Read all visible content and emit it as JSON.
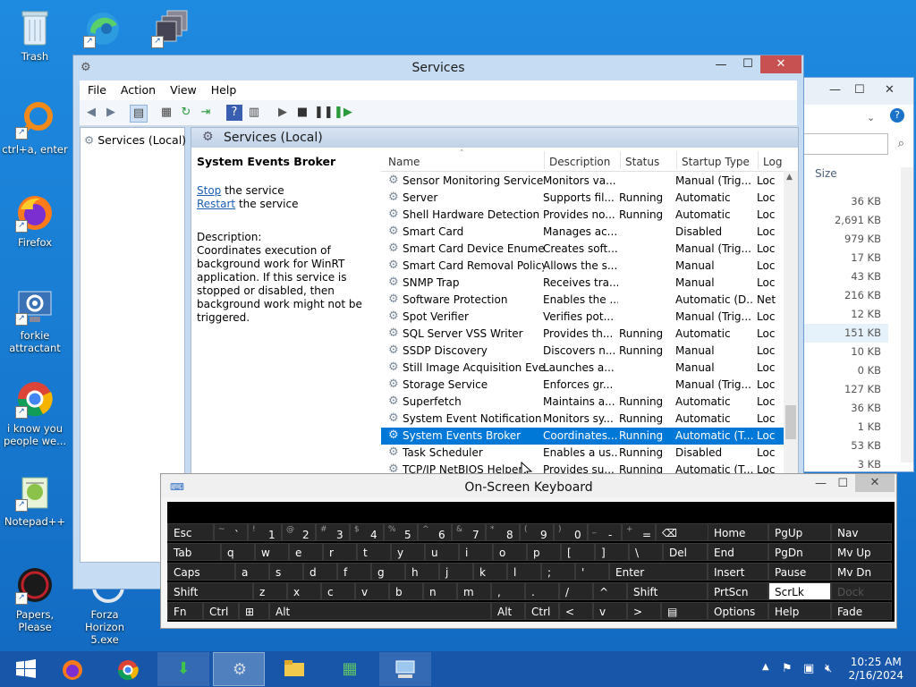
{
  "desktop": {
    "icons": [
      {
        "label": "Trash"
      },
      {
        "label": "ctrl+a, enter"
      },
      {
        "label": "Firefox"
      },
      {
        "label": "forkie attractant"
      },
      {
        "label": "i know you people we..."
      },
      {
        "label": "Notepad++"
      },
      {
        "label": "Papers, Please"
      },
      {
        "label": "Forza Horizon 5.exe"
      }
    ]
  },
  "explorer": {
    "size_header": "Size",
    "sizes": [
      "36 KB",
      "2,691 KB",
      "979 KB",
      "17 KB",
      "43 KB",
      "216 KB",
      "12 KB",
      "151 KB",
      "10 KB",
      "0 KB",
      "127 KB",
      "36 KB",
      "1 KB",
      "53 KB",
      "3 KB"
    ]
  },
  "services": {
    "title": "Services",
    "menu": [
      "File",
      "Action",
      "View",
      "Help"
    ],
    "tree_node": "Services (Local)",
    "header_title": "Services (Local)",
    "selected": {
      "name": "System Events Broker",
      "stop_link": "Stop",
      "stop_rest": " the service",
      "restart_link": "Restart",
      "restart_rest": " the service",
      "desc_label": "Description:",
      "desc_text": "Coordinates execution of background work for WinRT application. If this service is stopped or disabled, then background work might not be triggered."
    },
    "columns": [
      "Name",
      "Description",
      "Status",
      "Startup Type",
      "Log"
    ],
    "rows": [
      {
        "name": "Sensor Monitoring Service",
        "desc": "Monitors va...",
        "status": "",
        "startup": "Manual (Trig...",
        "log": "Loc"
      },
      {
        "name": "Server",
        "desc": "Supports fil...",
        "status": "Running",
        "startup": "Automatic",
        "log": "Loc"
      },
      {
        "name": "Shell Hardware Detection",
        "desc": "Provides no...",
        "status": "Running",
        "startup": "Automatic",
        "log": "Loc"
      },
      {
        "name": "Smart Card",
        "desc": "Manages ac...",
        "status": "",
        "startup": "Disabled",
        "log": "Loc"
      },
      {
        "name": "Smart Card Device Enumera...",
        "desc": "Creates soft...",
        "status": "",
        "startup": "Manual (Trig...",
        "log": "Loc"
      },
      {
        "name": "Smart Card Removal Policy",
        "desc": "Allows the s...",
        "status": "",
        "startup": "Manual",
        "log": "Loc"
      },
      {
        "name": "SNMP Trap",
        "desc": "Receives tra...",
        "status": "",
        "startup": "Manual",
        "log": "Loc"
      },
      {
        "name": "Software Protection",
        "desc": "Enables the ...",
        "status": "",
        "startup": "Automatic (D...",
        "log": "Net"
      },
      {
        "name": "Spot Verifier",
        "desc": "Verifies pot...",
        "status": "",
        "startup": "Manual (Trig...",
        "log": "Loc"
      },
      {
        "name": "SQL Server VSS Writer",
        "desc": "Provides th...",
        "status": "Running",
        "startup": "Automatic",
        "log": "Loc"
      },
      {
        "name": "SSDP Discovery",
        "desc": "Discovers n...",
        "status": "Running",
        "startup": "Manual",
        "log": "Loc"
      },
      {
        "name": "Still Image Acquisition Events",
        "desc": "Launches a...",
        "status": "",
        "startup": "Manual",
        "log": "Loc"
      },
      {
        "name": "Storage Service",
        "desc": "Enforces gr...",
        "status": "",
        "startup": "Manual (Trig...",
        "log": "Loc"
      },
      {
        "name": "Superfetch",
        "desc": "Maintains a...",
        "status": "Running",
        "startup": "Automatic",
        "log": "Loc"
      },
      {
        "name": "System Event Notification S...",
        "desc": "Monitors sy...",
        "status": "Running",
        "startup": "Automatic",
        "log": "Loc"
      },
      {
        "name": "System Events Broker",
        "desc": "Coordinates...",
        "status": "Running",
        "startup": "Automatic (T...",
        "log": "Loc"
      },
      {
        "name": "Task Scheduler",
        "desc": "Enables a us...",
        "status": "Running",
        "startup": "Disabled",
        "log": "Loc"
      },
      {
        "name": "TCP/IP NetBIOS Helper",
        "desc": "Provides su...",
        "status": "Running",
        "startup": "Automatic (T...",
        "log": "Loc"
      }
    ]
  },
  "osk": {
    "title": "On-Screen Keyboard",
    "row1": [
      [
        "Esc",
        ""
      ],
      [
        "`",
        "~"
      ],
      [
        "1",
        "!"
      ],
      [
        "2",
        "@"
      ],
      [
        "3",
        "#"
      ],
      [
        "4",
        "$"
      ],
      [
        "5",
        "%"
      ],
      [
        "6",
        "^"
      ],
      [
        "7",
        "&"
      ],
      [
        "8",
        "*"
      ],
      [
        "9",
        "("
      ],
      [
        "0",
        ")"
      ],
      [
        "-",
        "_"
      ],
      [
        "=",
        "+"
      ],
      [
        "⌫",
        ""
      ]
    ],
    "row2": [
      "Tab",
      "q",
      "w",
      "e",
      "r",
      "t",
      "y",
      "u",
      "i",
      "o",
      "p",
      "[",
      "]",
      "\\",
      "Del"
    ],
    "row3": [
      "Caps",
      "a",
      "s",
      "d",
      "f",
      "g",
      "h",
      "j",
      "k",
      "l",
      ";",
      "'",
      "Enter"
    ],
    "row4": [
      "Shift",
      "z",
      "x",
      "c",
      "v",
      "b",
      "n",
      "m",
      ",",
      ".",
      "/",
      "^",
      "Shift"
    ],
    "row5": [
      "Fn",
      "Ctrl",
      "⊞",
      "Alt",
      "Alt",
      "Ctrl",
      "<",
      "v",
      ">",
      "▤"
    ],
    "nav": [
      [
        "Home",
        "PgUp",
        "Nav"
      ],
      [
        "End",
        "PgDn",
        "Mv Up"
      ],
      [
        "Insert",
        "Pause",
        "Mv Dn"
      ],
      [
        "PrtScn",
        "ScrLk",
        "Dock"
      ],
      [
        "Options",
        "Help",
        "Fade"
      ]
    ]
  },
  "taskbar": {
    "time": "10:25 AM",
    "date": "2/16/2024"
  }
}
